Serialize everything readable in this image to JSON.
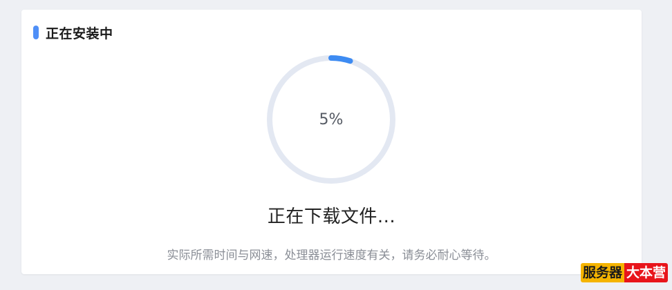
{
  "card": {
    "title": "正在安装中",
    "accent_color": "#4f8ff7"
  },
  "progress": {
    "percent": 5,
    "label": "5%",
    "track_color": "#e3e8f2",
    "fill_color": "#3d8bf2"
  },
  "status": {
    "text": "正在下载文件...",
    "hint": "实际所需时间与网速，处理器运行速度有关，请务必耐心等待。"
  },
  "watermark": {
    "part1": "服务器",
    "part2": "大本营"
  }
}
